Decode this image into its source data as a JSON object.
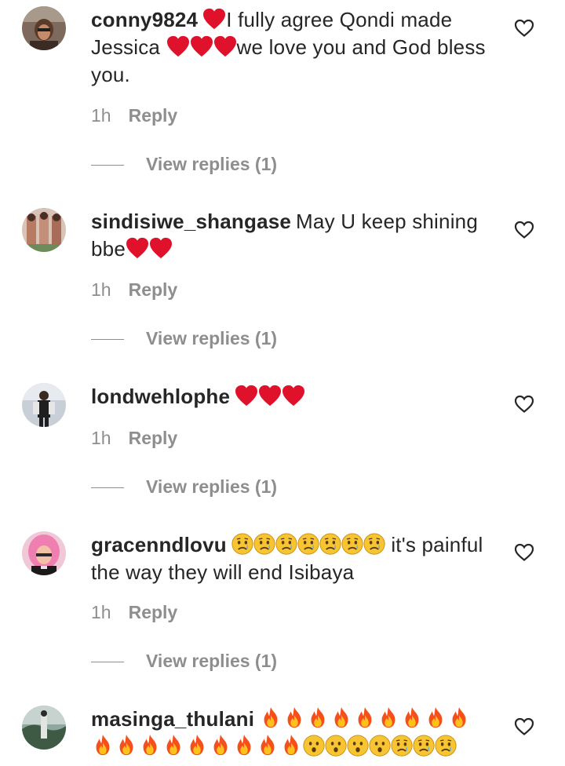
{
  "comments": [
    {
      "username": "conny9824",
      "text_before": "",
      "text_after": "I fully agree Qondi made Jessica",
      "text_after2": "we love you and God bless you.",
      "time": "1h",
      "reply_label": "Reply",
      "view_replies_label": "View replies (1)",
      "avatar": "user-photo"
    },
    {
      "username": "sindisiwe_shangase",
      "text_after": "May U keep shining bbe",
      "time": "1h",
      "reply_label": "Reply",
      "view_replies_label": "View replies (1)",
      "avatar": "user-photo"
    },
    {
      "username": "londwehlophe",
      "time": "1h",
      "reply_label": "Reply",
      "view_replies_label": "View replies (1)",
      "avatar": "user-photo"
    },
    {
      "username": "gracenndlovu",
      "text_after": "it's painful the way they will end Isibaya",
      "time": "1h",
      "reply_label": "Reply",
      "view_replies_label": "View replies (1)",
      "avatar": "user-photo"
    },
    {
      "username": "masinga_thulani",
      "avatar": "user-photo"
    }
  ],
  "icons": {
    "like": "heart-outline-icon",
    "emoji_heart": "red-heart",
    "emoji_sad": "sad-face",
    "emoji_fire": "fire",
    "emoji_surprised": "hushed-face"
  },
  "colors": {
    "text": "#262626",
    "muted": "#8e8e8e",
    "heart": "#e0112b"
  }
}
